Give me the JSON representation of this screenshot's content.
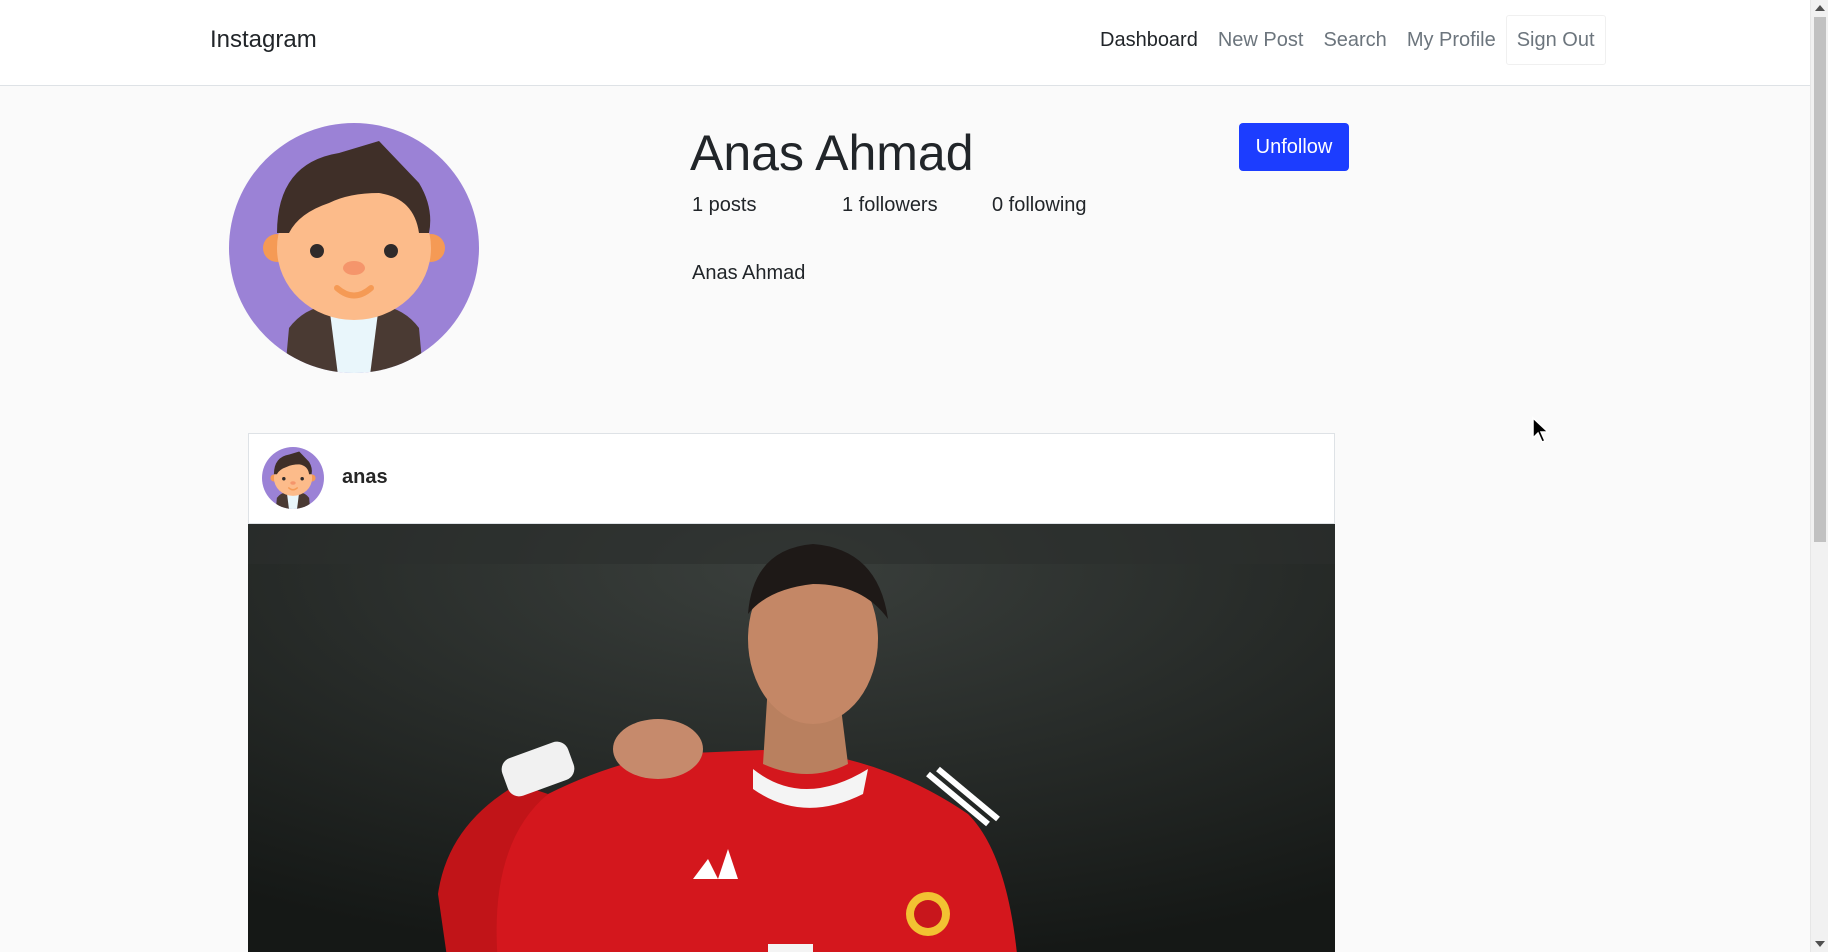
{
  "navbar": {
    "brand": "Instagram",
    "links": [
      {
        "label": "Dashboard",
        "active": true
      },
      {
        "label": "New Post",
        "active": false
      },
      {
        "label": "Search",
        "active": false
      },
      {
        "label": "My Profile",
        "active": false
      }
    ],
    "signout_label": "Sign Out"
  },
  "profile": {
    "name": "Anas Ahmad",
    "posts": "1 posts",
    "followers": "1 followers",
    "following": "0 following",
    "bio": "Anas Ahmad",
    "action_label": "Unfollow",
    "avatar_icon": "avatar-icon"
  },
  "post": {
    "username": "anas",
    "image_icon": "photo-image"
  },
  "colors": {
    "primary": "#1c3dff",
    "background": "#fafafa",
    "avatar_bg": "#9b82d6"
  }
}
